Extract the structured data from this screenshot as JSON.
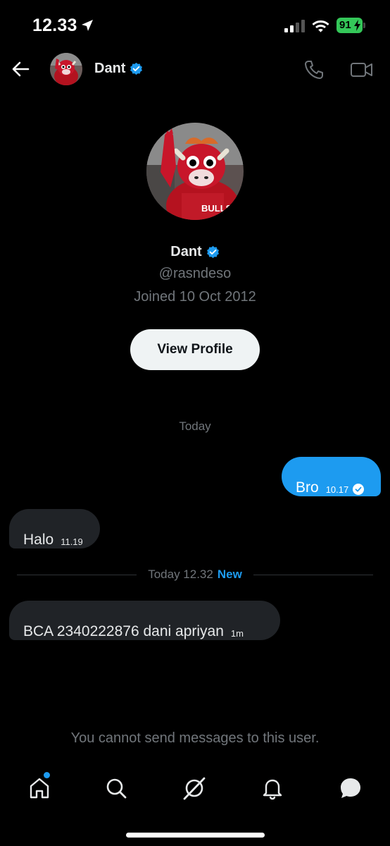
{
  "status_bar": {
    "time": "12.33",
    "battery": "91",
    "icons": [
      "location-arrow-icon",
      "cellular-signal-icon",
      "wifi-icon",
      "battery-charging-icon"
    ]
  },
  "header": {
    "name": "Dant",
    "icons": [
      "back-arrow-icon",
      "verified-badge-icon",
      "phone-icon",
      "video-camera-icon"
    ]
  },
  "profile": {
    "name": "Dant",
    "handle": "@rasndeso",
    "joined": "Joined 10 Oct 2012",
    "view_profile_label": "View Profile"
  },
  "conversation": {
    "day_label": "Today",
    "messages": [
      {
        "direction": "outgoing",
        "text": "Bro",
        "time": "10.17",
        "status": "read"
      },
      {
        "direction": "incoming",
        "text": "Halo",
        "time": "11.19"
      },
      {
        "direction": "incoming",
        "text": "BCA 2340222876 dani apriyan",
        "time": "1m"
      }
    ],
    "new_divider": {
      "label": "Today 12.32",
      "badge": "New"
    },
    "cannot_send": "You cannot send messages to this user."
  },
  "bottom_nav": {
    "items": [
      "home-icon",
      "search-icon",
      "grok-icon",
      "notifications-bell-icon",
      "messages-icon"
    ],
    "home_has_notification_dot": true
  },
  "colors": {
    "background": "#000000",
    "accent": "#1d9bf0",
    "incoming_bubble": "#202327",
    "muted_text": "#71767b",
    "battery": "#34c759"
  }
}
